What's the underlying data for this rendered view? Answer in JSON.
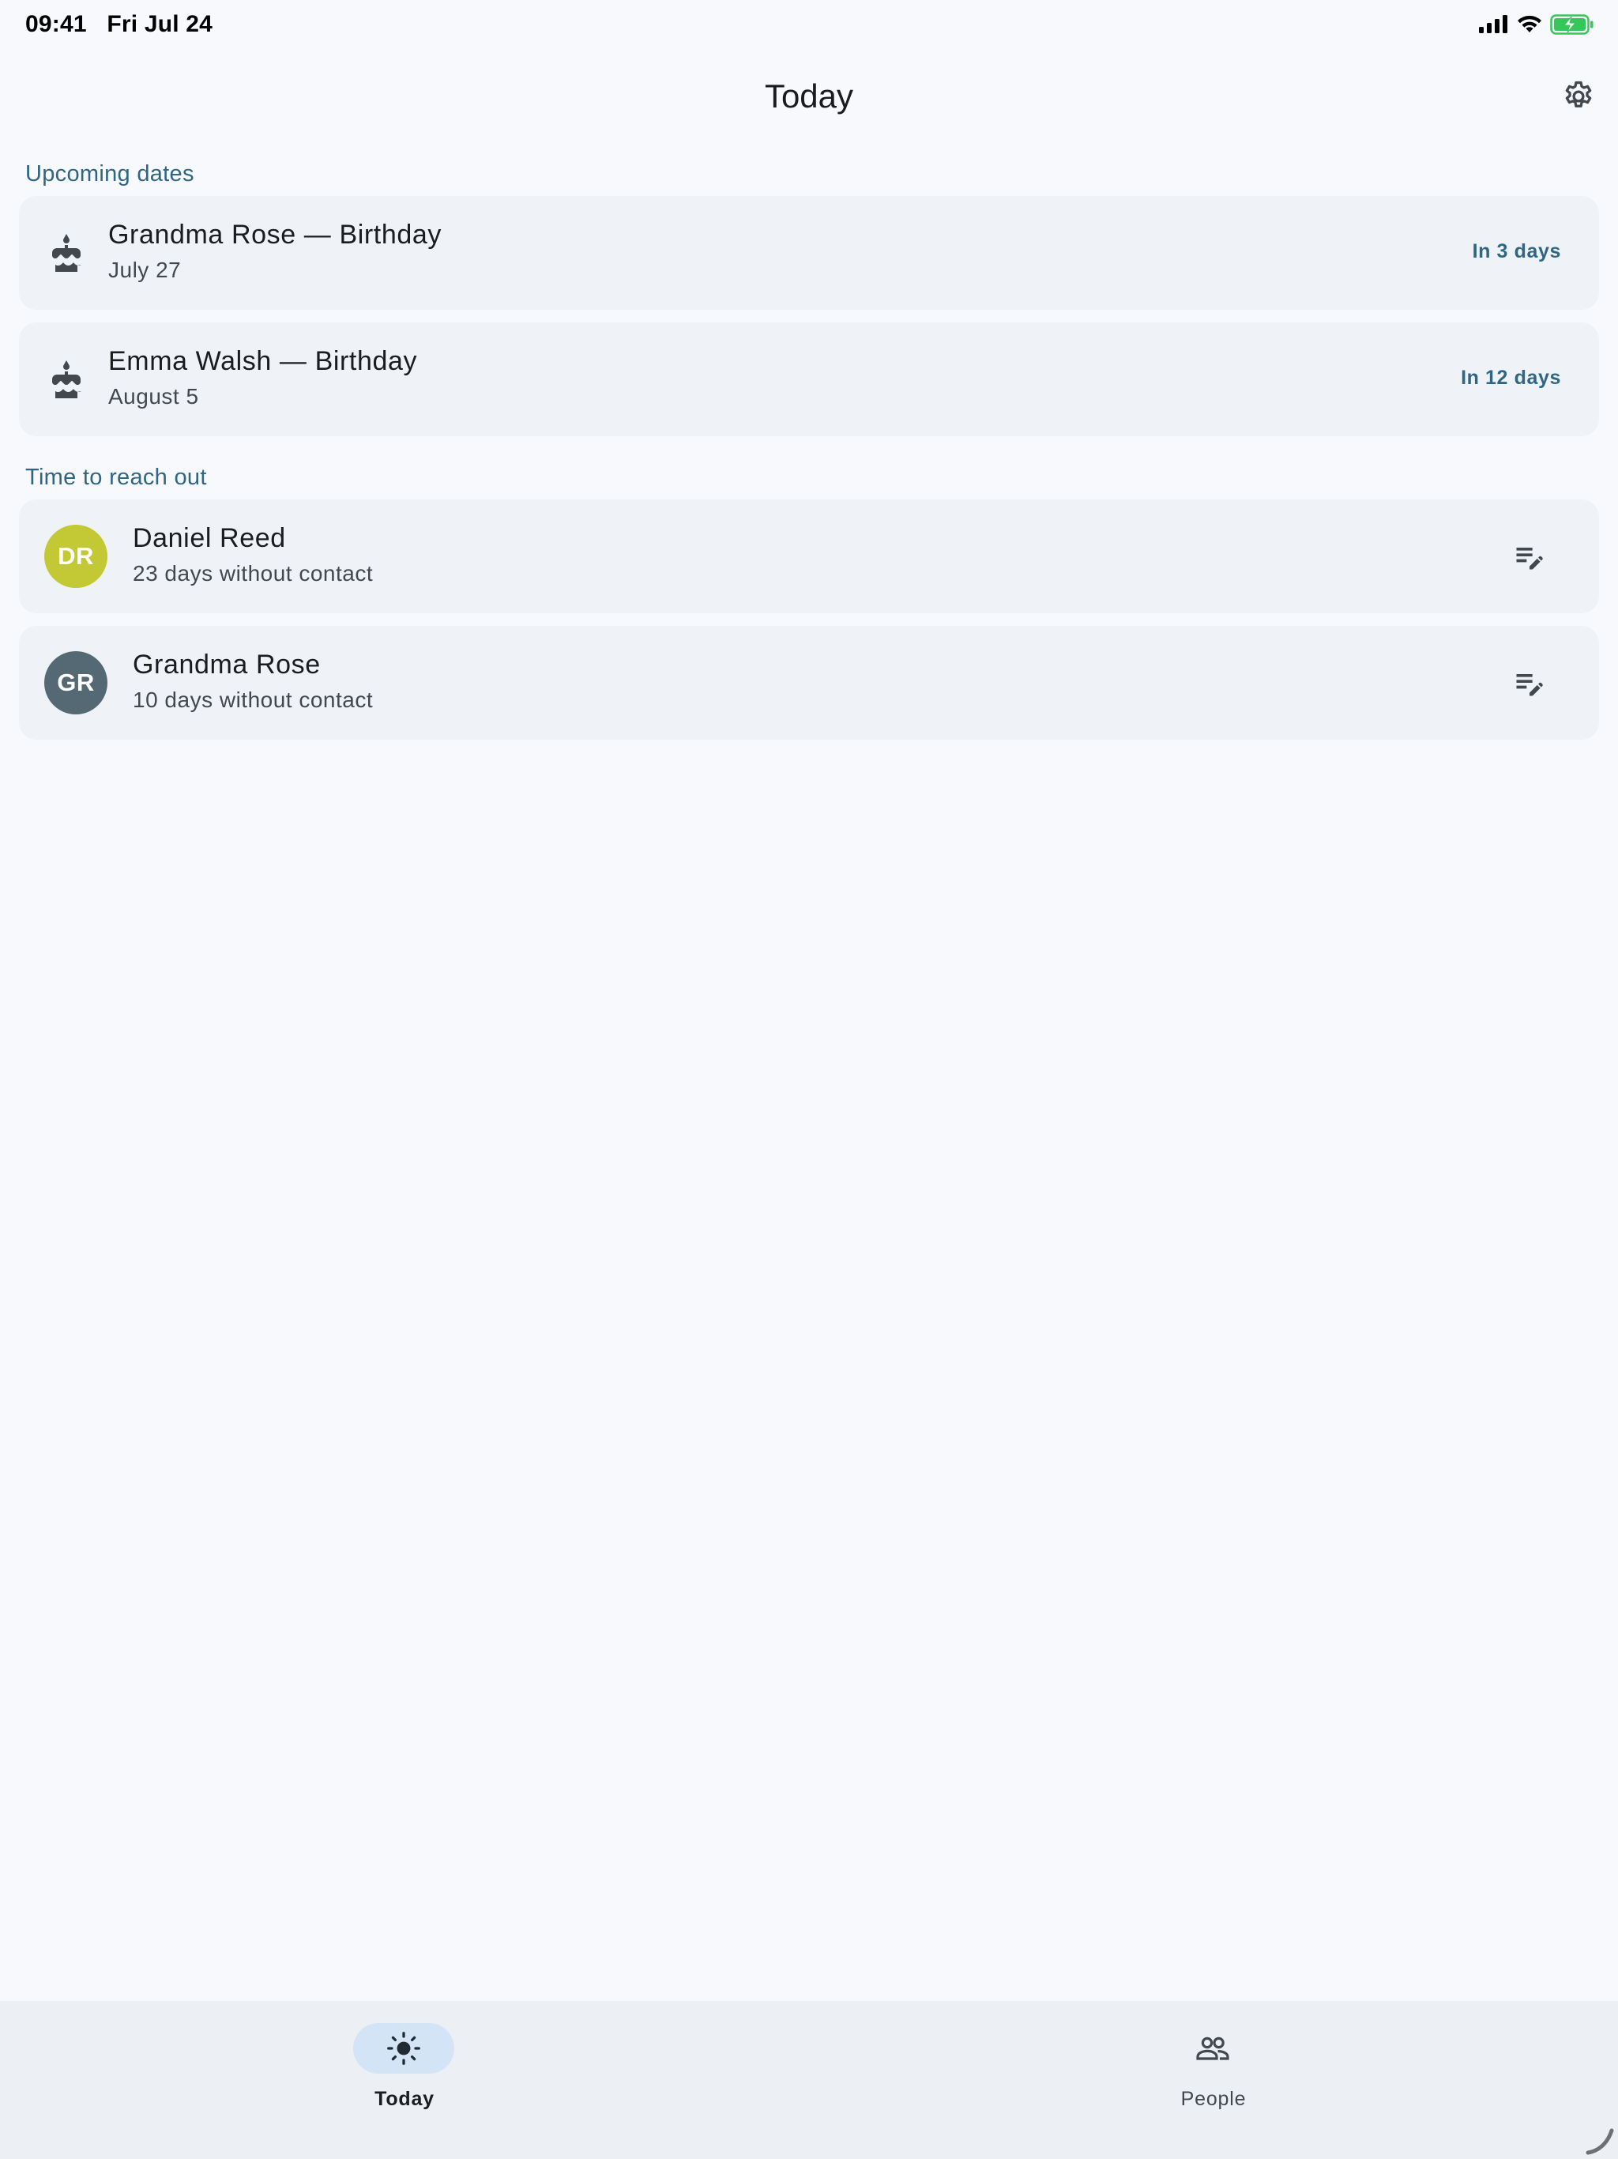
{
  "status_bar": {
    "time": "09:41",
    "date": "Fri Jul 24",
    "battery_color": "#34c759"
  },
  "app_bar": {
    "title": "Today",
    "settings_icon": "gear-icon"
  },
  "upcoming": {
    "title": "Upcoming dates",
    "items": [
      {
        "title": "Grandma Rose — Birthday",
        "date": "July 27",
        "countdown": "In 3 days",
        "icon": "cake-icon"
      },
      {
        "title": "Emma Walsh — Birthday",
        "date": "August 5",
        "countdown": "In 12 days",
        "icon": "cake-icon"
      }
    ]
  },
  "reach_out": {
    "title": "Time to reach out",
    "items": [
      {
        "initials": "DR",
        "name": "Daniel Reed",
        "detail": "23 days without contact",
        "avatar_color": "#c3c934",
        "action_icon": "edit-note-icon"
      },
      {
        "initials": "GR",
        "name": "Grandma Rose",
        "detail": "10 days without contact",
        "avatar_color": "#546973",
        "action_icon": "edit-note-icon"
      }
    ]
  },
  "bottom_nav": {
    "items": [
      {
        "label": "Today",
        "icon": "sun-icon",
        "active": true
      },
      {
        "label": "People",
        "icon": "people-icon",
        "active": false
      }
    ]
  },
  "colors": {
    "background": "#f7f9fd",
    "card": "#eff3f8",
    "accent": "#2f6683",
    "nav_background": "#eceff3",
    "nav_active_pill": "#d3e4f6"
  }
}
